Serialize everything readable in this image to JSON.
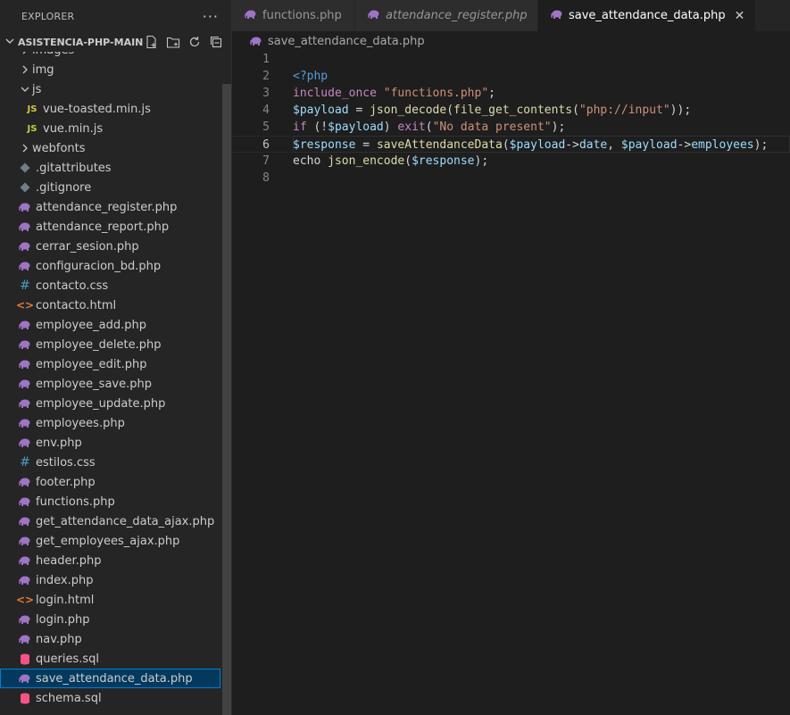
{
  "explorer": {
    "title": "EXPLORER",
    "more_label": "···",
    "project": "ASISTENCIA-PHP-MAIN",
    "items": [
      {
        "label": "images",
        "kind": "folder-collapsed",
        "indent": 1
      },
      {
        "label": "img",
        "kind": "folder-collapsed",
        "indent": 1
      },
      {
        "label": "js",
        "kind": "folder-open",
        "indent": 1
      },
      {
        "label": "vue-toasted.min.js",
        "kind": "js",
        "indent": 2
      },
      {
        "label": "vue.min.js",
        "kind": "js",
        "indent": 2
      },
      {
        "label": "webfonts",
        "kind": "folder-collapsed",
        "indent": 1
      },
      {
        "label": ".gitattributes",
        "kind": "git",
        "indent": 1
      },
      {
        "label": ".gitignore",
        "kind": "git",
        "indent": 1
      },
      {
        "label": "attendance_register.php",
        "kind": "php",
        "indent": 1
      },
      {
        "label": "attendance_report.php",
        "kind": "php",
        "indent": 1
      },
      {
        "label": "cerrar_sesion.php",
        "kind": "php",
        "indent": 1
      },
      {
        "label": "configuracion_bd.php",
        "kind": "php",
        "indent": 1
      },
      {
        "label": "contacto.css",
        "kind": "css",
        "indent": 1
      },
      {
        "label": "contacto.html",
        "kind": "html",
        "indent": 1
      },
      {
        "label": "employee_add.php",
        "kind": "php",
        "indent": 1
      },
      {
        "label": "employee_delete.php",
        "kind": "php",
        "indent": 1
      },
      {
        "label": "employee_edit.php",
        "kind": "php",
        "indent": 1
      },
      {
        "label": "employee_save.php",
        "kind": "php",
        "indent": 1
      },
      {
        "label": "employee_update.php",
        "kind": "php",
        "indent": 1
      },
      {
        "label": "employees.php",
        "kind": "php",
        "indent": 1
      },
      {
        "label": "env.php",
        "kind": "php",
        "indent": 1
      },
      {
        "label": "estilos.css",
        "kind": "css",
        "indent": 1
      },
      {
        "label": "footer.php",
        "kind": "php",
        "indent": 1
      },
      {
        "label": "functions.php",
        "kind": "php",
        "indent": 1
      },
      {
        "label": "get_attendance_data_ajax.php",
        "kind": "php",
        "indent": 1
      },
      {
        "label": "get_employees_ajax.php",
        "kind": "php",
        "indent": 1
      },
      {
        "label": "header.php",
        "kind": "php",
        "indent": 1
      },
      {
        "label": "index.php",
        "kind": "php",
        "indent": 1
      },
      {
        "label": "login.html",
        "kind": "html",
        "indent": 1
      },
      {
        "label": "login.php",
        "kind": "php",
        "indent": 1
      },
      {
        "label": "nav.php",
        "kind": "php",
        "indent": 1
      },
      {
        "label": "queries.sql",
        "kind": "sql",
        "indent": 1
      },
      {
        "label": "save_attendance_data.php",
        "kind": "php",
        "indent": 1,
        "selected": true
      },
      {
        "label": "schema.sql",
        "kind": "sql",
        "indent": 1
      }
    ]
  },
  "tabs": [
    {
      "label": "functions.php",
      "active": false,
      "italic": false
    },
    {
      "label": "attendance_register.php",
      "active": false,
      "italic": true
    },
    {
      "label": "save_attendance_data.php",
      "active": true,
      "italic": false,
      "close": "✕"
    }
  ],
  "breadcrumb": "save_attendance_data.php",
  "editor": {
    "current_line": 6,
    "lines": [
      {
        "n": "1",
        "tokens": []
      },
      {
        "n": "2",
        "tokens": [
          [
            "t-tag",
            "<?php"
          ]
        ]
      },
      {
        "n": "3",
        "tokens": [
          [
            "t-kw",
            "include_once"
          ],
          [
            "t-op",
            " "
          ],
          [
            "t-str",
            "\"functions.php\""
          ],
          [
            "t-op",
            ";"
          ]
        ]
      },
      {
        "n": "4",
        "tokens": [
          [
            "t-var",
            "$payload"
          ],
          [
            "t-op",
            " = "
          ],
          [
            "t-fn",
            "json_decode"
          ],
          [
            "t-op",
            "("
          ],
          [
            "t-fn",
            "file_get_contents"
          ],
          [
            "t-op",
            "("
          ],
          [
            "t-str",
            "\"php://input\""
          ],
          [
            "t-op",
            "));"
          ]
        ]
      },
      {
        "n": "5",
        "tokens": [
          [
            "t-ctl",
            "if"
          ],
          [
            "t-op",
            " (!"
          ],
          [
            "t-var",
            "$payload"
          ],
          [
            "t-op",
            ") "
          ],
          [
            "t-ctl",
            "exit"
          ],
          [
            "t-op",
            "("
          ],
          [
            "t-str",
            "\"No data present\""
          ],
          [
            "t-op",
            ");"
          ]
        ]
      },
      {
        "n": "6",
        "tokens": [
          [
            "t-var",
            "$response"
          ],
          [
            "t-op",
            " = "
          ],
          [
            "t-fn",
            "saveAttendanceData"
          ],
          [
            "t-op",
            "("
          ],
          [
            "t-var",
            "$payload"
          ],
          [
            "t-op",
            "->"
          ],
          [
            "t-prop",
            "date"
          ],
          [
            "t-op",
            ", "
          ],
          [
            "t-var",
            "$payload"
          ],
          [
            "t-op",
            "->"
          ],
          [
            "t-prop",
            "employees"
          ],
          [
            "t-op",
            ");"
          ]
        ]
      },
      {
        "n": "7",
        "tokens": [
          [
            "t-op",
            "echo "
          ],
          [
            "t-fn",
            "json_encode"
          ],
          [
            "t-op",
            "("
          ],
          [
            "t-var",
            "$response"
          ],
          [
            "t-op",
            ");"
          ]
        ]
      },
      {
        "n": "8",
        "tokens": []
      }
    ]
  },
  "colors": {
    "php": "#a074c4",
    "js": "#cbcb41",
    "css": "#519aba",
    "html": "#e37933",
    "git": "#6d8086",
    "sql": "#f55385"
  }
}
